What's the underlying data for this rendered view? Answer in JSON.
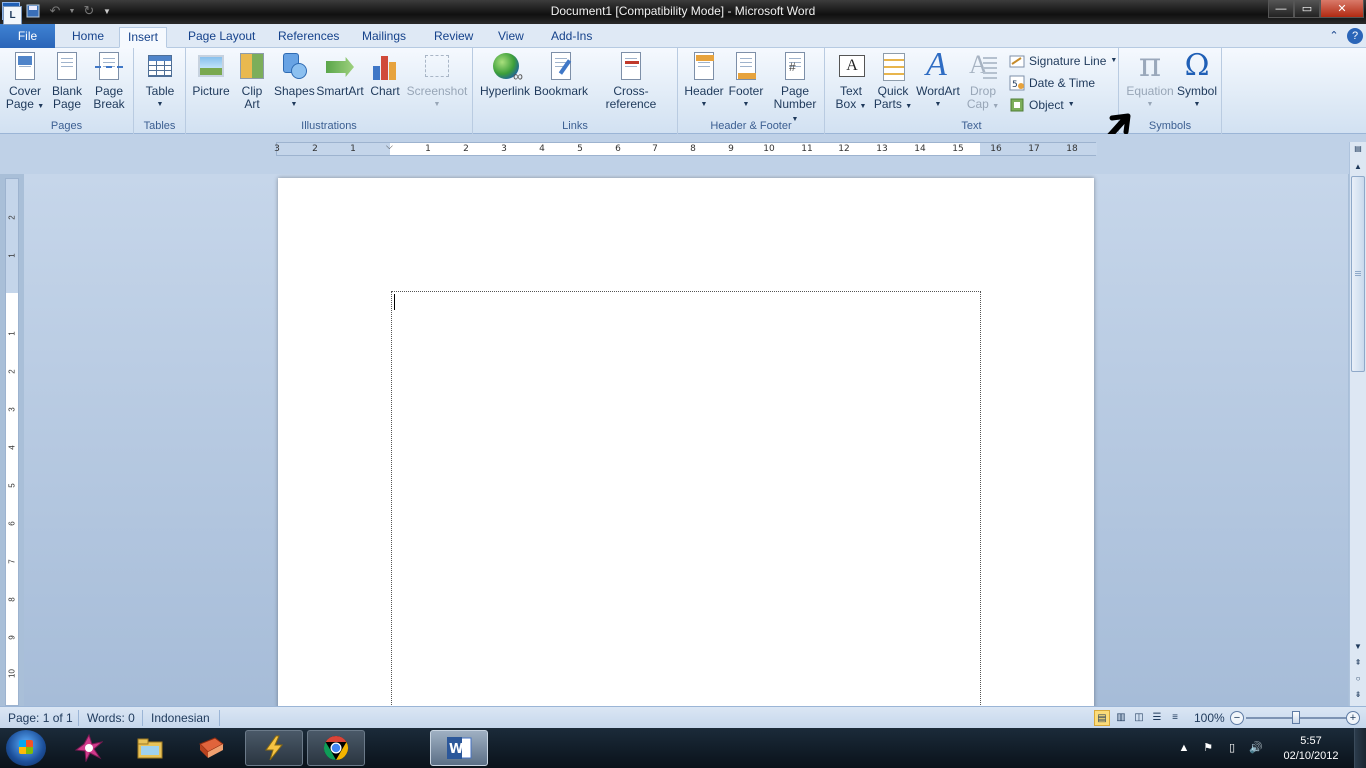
{
  "window": {
    "title": "Document1 [Compatibility Mode]  -  Microsoft Word",
    "minimize": "—",
    "maximize": "▭",
    "close": "✕"
  },
  "qat": {
    "logo": "W"
  },
  "tabs": {
    "file": "File",
    "items": [
      "Home",
      "Insert",
      "Page Layout",
      "References",
      "Mailings",
      "Review",
      "View",
      "Add-Ins"
    ],
    "active": "Insert"
  },
  "ribbon": {
    "pages": {
      "label": "Pages",
      "cover_page": [
        "Cover",
        "Page"
      ],
      "blank_page": [
        "Blank",
        "Page"
      ],
      "page_break": [
        "Page",
        "Break"
      ]
    },
    "tables": {
      "label": "Tables",
      "table": "Table"
    },
    "illustrations": {
      "label": "Illustrations",
      "picture": "Picture",
      "clip_art": [
        "Clip",
        "Art"
      ],
      "shapes": "Shapes",
      "smartart": "SmartArt",
      "chart": "Chart",
      "screenshot": "Screenshot"
    },
    "links": {
      "label": "Links",
      "hyperlink": "Hyperlink",
      "bookmark": "Bookmark",
      "cross_reference": "Cross-reference"
    },
    "header_footer": {
      "label": "Header & Footer",
      "header": "Header",
      "footer": "Footer",
      "page_number": [
        "Page",
        "Number"
      ]
    },
    "text": {
      "label": "Text",
      "text_box": [
        "Text",
        "Box"
      ],
      "quick_parts": [
        "Quick",
        "Parts"
      ],
      "wordart": "WordArt",
      "drop_cap": [
        "Drop",
        "Cap"
      ],
      "signature_line": "Signature Line",
      "date_time": "Date & Time",
      "object": "Object"
    },
    "symbols": {
      "label": "Symbols",
      "equation": "Equation",
      "symbol": "Symbol"
    }
  },
  "ruler": {
    "ticks": [
      "3",
      "2",
      "1",
      "1",
      "2",
      "3",
      "4",
      "5",
      "6",
      "7",
      "8",
      "9",
      "10",
      "11",
      "12",
      "13",
      "14",
      "15",
      "16",
      "17",
      "18"
    ],
    "vticks": [
      "2",
      "1",
      "1",
      "2",
      "3",
      "4",
      "5",
      "6",
      "7",
      "8",
      "9",
      "10"
    ],
    "corner": "L"
  },
  "statusbar": {
    "page": "Page: 1 of 1",
    "words": "Words: 0",
    "language": "Indonesian",
    "zoom": "100%"
  },
  "taskbar": {
    "time": "5:57",
    "date": "02/10/2012"
  },
  "colors": {
    "file_tab": "#2a65b8",
    "ribbon_bg": "#dce8f5",
    "doc_bg": "#a6bcd8"
  }
}
